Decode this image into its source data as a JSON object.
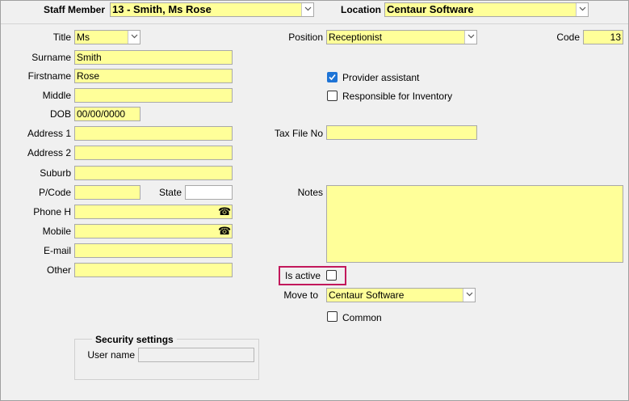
{
  "header": {
    "staff_member_label": "Staff Member",
    "staff_member_value": "13 - Smith, Ms Rose",
    "location_label": "Location",
    "location_value": "Centaur Software"
  },
  "form": {
    "title": {
      "label": "Title",
      "value": "Ms"
    },
    "surname": {
      "label": "Surname",
      "value": "Smith"
    },
    "firstname": {
      "label": "Firstname",
      "value": "Rose"
    },
    "middle": {
      "label": "Middle",
      "value": ""
    },
    "dob": {
      "label": "DOB",
      "value": "00/00/0000"
    },
    "address1": {
      "label": "Address 1",
      "value": ""
    },
    "address2": {
      "label": "Address 2",
      "value": ""
    },
    "suburb": {
      "label": "Suburb",
      "value": ""
    },
    "pcode": {
      "label": "P/Code",
      "value": ""
    },
    "state": {
      "label": "State",
      "value": ""
    },
    "phone_h": {
      "label": "Phone H",
      "value": ""
    },
    "mobile": {
      "label": "Mobile",
      "value": ""
    },
    "email": {
      "label": "E-mail",
      "value": ""
    },
    "other": {
      "label": "Other",
      "value": ""
    },
    "position": {
      "label": "Position",
      "value": "Receptionist"
    },
    "code": {
      "label": "Code",
      "value": "13"
    },
    "provider_assistant": {
      "label": "Provider assistant",
      "checked": true
    },
    "responsible_inventory": {
      "label": "Responsible for Inventory",
      "checked": false
    },
    "tax_file_no": {
      "label": "Tax File No",
      "value": ""
    },
    "notes": {
      "label": "Notes",
      "value": ""
    },
    "is_active": {
      "label": "Is active",
      "checked": false
    },
    "move_to": {
      "label": "Move to",
      "value": "Centaur Software"
    },
    "common": {
      "label": "Common",
      "checked": false
    }
  },
  "security": {
    "title": "Security settings",
    "username_label": "User name",
    "username_value": ""
  },
  "icons": {
    "dropdown": "chevron-down-icon",
    "phone": "telephone-icon",
    "check": "checkmark-icon"
  },
  "colors": {
    "field_bg": "#ffff99",
    "checkbox_checked": "#1e74d6",
    "highlight_border": "#c2185b"
  }
}
